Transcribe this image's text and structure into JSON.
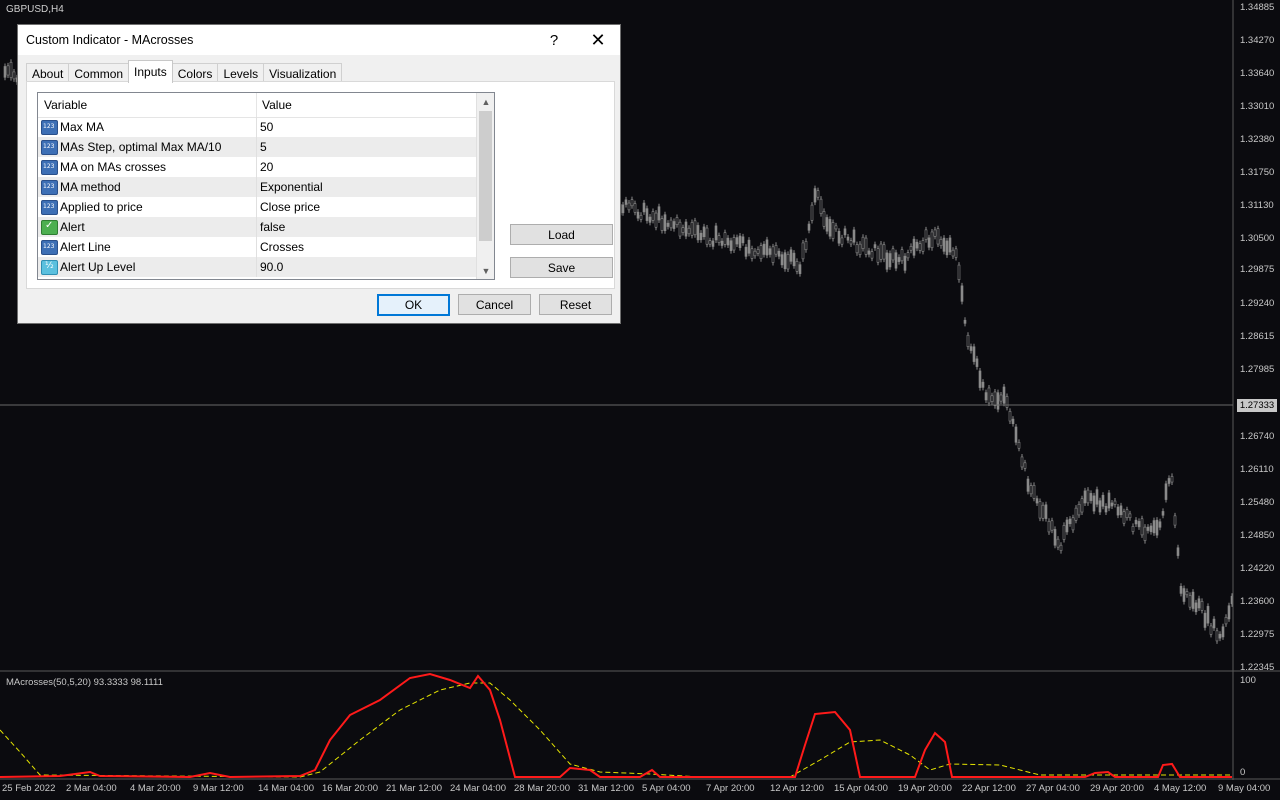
{
  "chart": {
    "symbol": "GBPUSD,H4",
    "indicator_label": "MAcrosses(50,5,20) 93.3333 98.1111",
    "price_labels": [
      "1.34885",
      "1.34270",
      "1.33640",
      "1.33010",
      "1.32380",
      "1.31750",
      "1.31130",
      "1.30500",
      "1.29875",
      "1.29240",
      "1.28615",
      "1.27985",
      "1.27333",
      "1.26740",
      "1.26110",
      "1.25480",
      "1.24850",
      "1.24220",
      "1.23600",
      "1.22975",
      "1.22345"
    ],
    "current_price": "1.27333",
    "indicator_levels": [
      "100",
      "0"
    ],
    "time_labels": [
      "25 Feb 2022",
      "2 Mar 04:00",
      "4 Mar 20:00",
      "9 Mar 12:00",
      "14 Mar 04:00",
      "16 Mar 20:00",
      "21 Mar 12:00",
      "24 Mar 04:00",
      "28 Mar 20:00",
      "31 Mar 12:00",
      "5 Apr 04:00",
      "7 Apr 20:00",
      "12 Apr 12:00",
      "15 Apr 04:00",
      "19 Apr 20:00",
      "22 Apr 12:00",
      "27 Apr 04:00",
      "29 Apr 20:00",
      "4 May 12:00",
      "9 May 04:00"
    ],
    "colors": {
      "background": "#0b0b0f",
      "candle": "#8a8a8a",
      "fast_line": "#ff1a1a",
      "slow_line": "#e6e600"
    }
  },
  "dialog": {
    "title": "Custom Indicator - MAcrosses",
    "help": "?",
    "close": "✕",
    "tabs": [
      "About",
      "Common",
      "Inputs",
      "Colors",
      "Levels",
      "Visualization"
    ],
    "active_tab": "Inputs",
    "headers": {
      "variable": "Variable",
      "value": "Value"
    },
    "rows": [
      {
        "icon": "number-icon",
        "variable": "Max MA",
        "value": "50"
      },
      {
        "icon": "number-icon",
        "variable": "MAs Step, optimal Max MA/10",
        "value": "5"
      },
      {
        "icon": "number-icon",
        "variable": "MA on MAs crosses",
        "value": "20"
      },
      {
        "icon": "number-icon",
        "variable": "MA method",
        "value": "Exponential"
      },
      {
        "icon": "number-icon",
        "variable": "Applied to price",
        "value": "Close price"
      },
      {
        "icon": "boolean-icon",
        "variable": "Alert",
        "value": "false"
      },
      {
        "icon": "number-icon",
        "variable": "Alert Line",
        "value": "Crosses"
      },
      {
        "icon": "double-icon",
        "variable": "Alert Up Level",
        "value": "90.0"
      }
    ],
    "load": "Load",
    "save": "Save",
    "ok": "OK",
    "cancel": "Cancel",
    "reset": "Reset"
  }
}
